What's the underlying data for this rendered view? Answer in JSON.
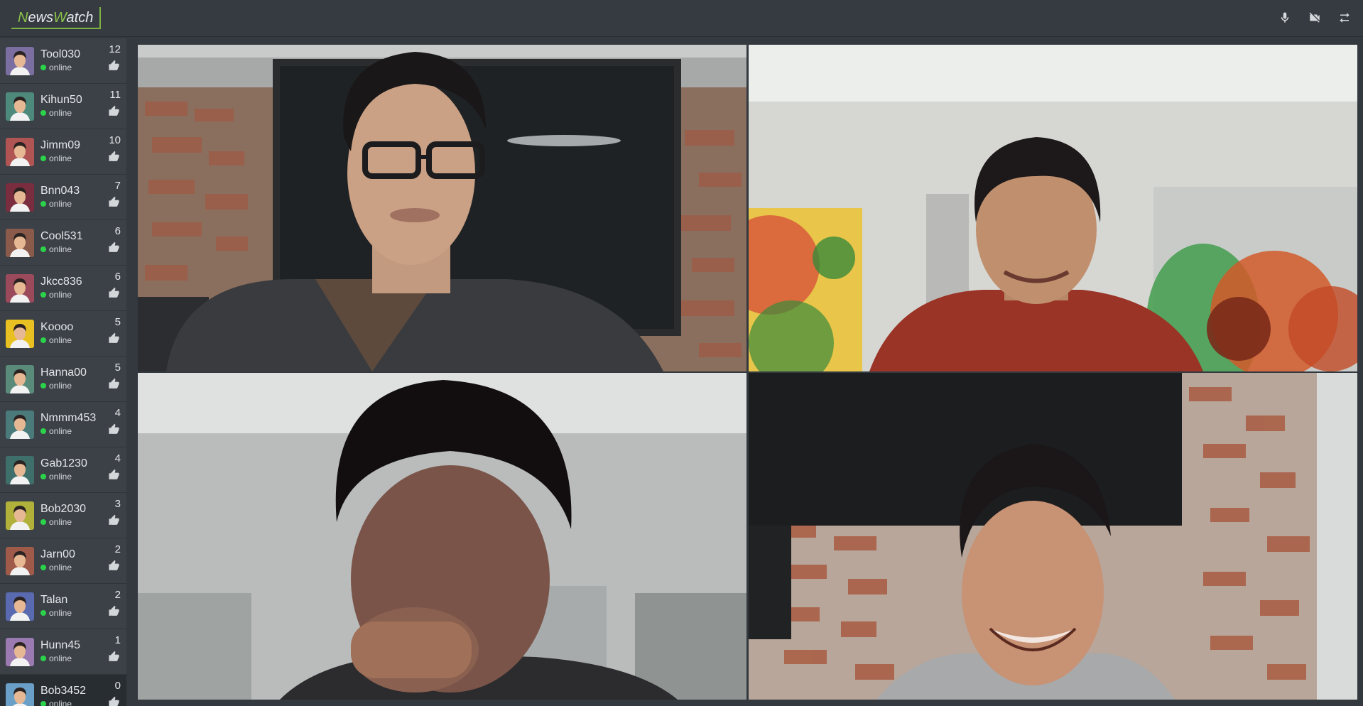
{
  "app": {
    "logo_n": "N",
    "logo_ews": "ews",
    "logo_w": "W",
    "logo_atch": "atch"
  },
  "toolbar": {
    "icons": [
      "microphone-icon",
      "video-off-icon",
      "swap-icon"
    ]
  },
  "users": [
    {
      "name": "Tool030",
      "status": "online",
      "likes": "12",
      "avatar_bg": "#7b6ea1"
    },
    {
      "name": "Kihun50",
      "status": "online",
      "likes": "11",
      "avatar_bg": "#4e8a7c"
    },
    {
      "name": "Jimm09",
      "status": "online",
      "likes": "10",
      "avatar_bg": "#b05454"
    },
    {
      "name": "Bnn043",
      "status": "online",
      "likes": "7",
      "avatar_bg": "#7a2d3e"
    },
    {
      "name": "Cool531",
      "status": "online",
      "likes": "6",
      "avatar_bg": "#8a5a4a"
    },
    {
      "name": "Jkcc836",
      "status": "online",
      "likes": "6",
      "avatar_bg": "#9a4a5a"
    },
    {
      "name": "Koooo",
      "status": "online",
      "likes": "5",
      "avatar_bg": "#e8c022"
    },
    {
      "name": "Hanna00",
      "status": "online",
      "likes": "5",
      "avatar_bg": "#5a8a7a"
    },
    {
      "name": "Nmmm453",
      "status": "online",
      "likes": "4",
      "avatar_bg": "#4a7a7a"
    },
    {
      "name": "Gab1230",
      "status": "online",
      "likes": "4",
      "avatar_bg": "#3f6f6a"
    },
    {
      "name": "Bob2030",
      "status": "online",
      "likes": "3",
      "avatar_bg": "#b0b03a"
    },
    {
      "name": "Jarn00",
      "status": "online",
      "likes": "2",
      "avatar_bg": "#a05a4a"
    },
    {
      "name": "Talan",
      "status": "online",
      "likes": "2",
      "avatar_bg": "#5a6ab0"
    },
    {
      "name": "Hunn45",
      "status": "online",
      "likes": "1",
      "avatar_bg": "#9a7ab0"
    },
    {
      "name": "Bob3452",
      "status": "online",
      "likes": "0",
      "avatar_bg": "#6aa0c8"
    }
  ],
  "colors": {
    "status_online": "#2bd34a",
    "brand_accent": "#8bc34a"
  }
}
